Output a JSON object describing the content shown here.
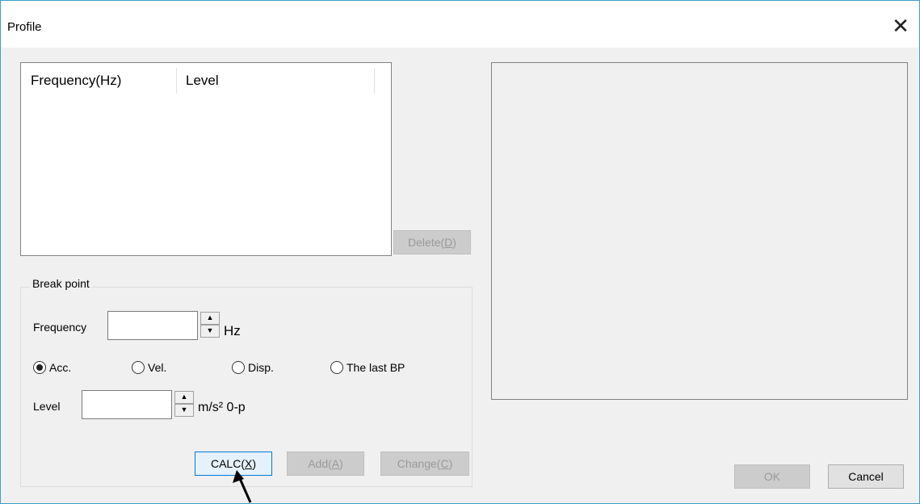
{
  "window": {
    "title": "Profile",
    "close_glyph": "✕"
  },
  "list": {
    "columns": [
      "Frequency(Hz)",
      "Level"
    ]
  },
  "buttons": {
    "delete": {
      "pre": "Delete(",
      "key": "D",
      "post": ")"
    },
    "calc": {
      "pre": "CALC(",
      "key": "X",
      "post": ")"
    },
    "add": {
      "pre": "Add(",
      "key": "A",
      "post": ")"
    },
    "change": {
      "pre": "Change(",
      "key": "C",
      "post": ")"
    },
    "ok": "OK",
    "cancel": "Cancel"
  },
  "breakpoint": {
    "group_label": "Break point",
    "frequency_label": "Frequency",
    "frequency_value": "",
    "frequency_unit": "Hz",
    "level_label": "Level",
    "level_value": "",
    "level_unit": "m/s² 0-p",
    "radios": [
      {
        "label": "Acc.",
        "checked": true
      },
      {
        "label": "Vel.",
        "checked": false
      },
      {
        "label": "Disp.",
        "checked": false
      },
      {
        "label": "The last BP",
        "checked": false
      }
    ]
  },
  "icons": {
    "spin_up": "spin-up-arrow-icon",
    "spin_down": "spin-down-arrow-icon",
    "pointer": "mouse-pointer-icon"
  }
}
